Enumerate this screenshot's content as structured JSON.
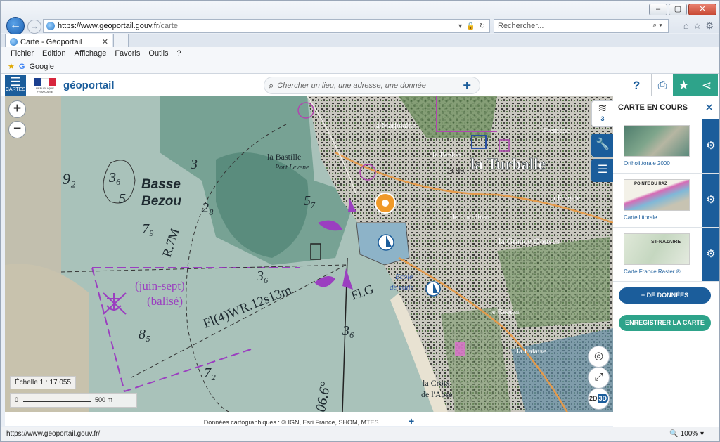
{
  "browser": {
    "url_host": "https://www.geoportail.gouv.fr",
    "url_path": "/carte",
    "search_placeholder": "Rechercher...",
    "tab_title": "Carte - Géoportail",
    "menu": [
      "Fichier",
      "Edition",
      "Affichage",
      "Favoris",
      "Outils",
      "?"
    ],
    "favorites": [
      {
        "label": "Google"
      }
    ],
    "status_url": "https://www.geoportail.gouv.fr/",
    "zoom": "100%"
  },
  "header": {
    "cartes_label": "CARTES",
    "logo": "géoportail",
    "search_placeholder": "Chercher un lieu, une adresse, une donnée",
    "help": "?"
  },
  "map": {
    "scale": "Échelle 1 : 17 055",
    "scale_min": "0",
    "scale_max": "500 m",
    "layers_count": "3",
    "attribution": "Données cartographiques : ©    IGN,  Esri France,  SHOM,  MTES",
    "labels": {
      "turballe": "la Turballe",
      "bastille": "la Bastille",
      "port_levenes": "Port Levene",
      "basse": "Basse",
      "bezou": "Bezou",
      "marjolaine": "la Marjolaine",
      "penker": "le Penker",
      "fremeac": "Fremeac",
      "locbihen": "le Locbihen",
      "grande_douves": "la Grande Douves",
      "frégate": "la Frégate",
      "requer": "le Requer",
      "falaise": "la Falaise",
      "croix": "la Croix",
      "aose": "de l'Aose",
      "juin": "(juin-sept)",
      "balise": "(balisé)",
      "light": "Fl(4)WR.12s13m",
      "fig": "Fl.G",
      "ecole": "Ecole",
      "voile": "de voile",
      "r7m": "R.7M",
      "depths": [
        "92",
        "36",
        "5",
        "3",
        "28",
        "79",
        "57",
        "36",
        "85",
        "72",
        "36",
        "06.6"
      ],
      "d99": "D 99",
      "plage": "Plage des Bretons"
    }
  },
  "panel": {
    "title": "CARTE EN COURS",
    "layers": [
      {
        "name": "Ortholittorale 2000"
      },
      {
        "name": "Carte littorale",
        "thumb_text": "POINTE DU RAZ"
      },
      {
        "name": "Carte France Raster ®",
        "thumb_text": "ST-NAZAIRE"
      }
    ],
    "add_data": "+ DE DONNÉES",
    "save_map": "ENREGISTRER LA CARTE"
  },
  "colors": {
    "gp_blue": "#1b5d9b",
    "gp_green": "#2ea38a",
    "chart_purple": "#9b3fc0"
  }
}
